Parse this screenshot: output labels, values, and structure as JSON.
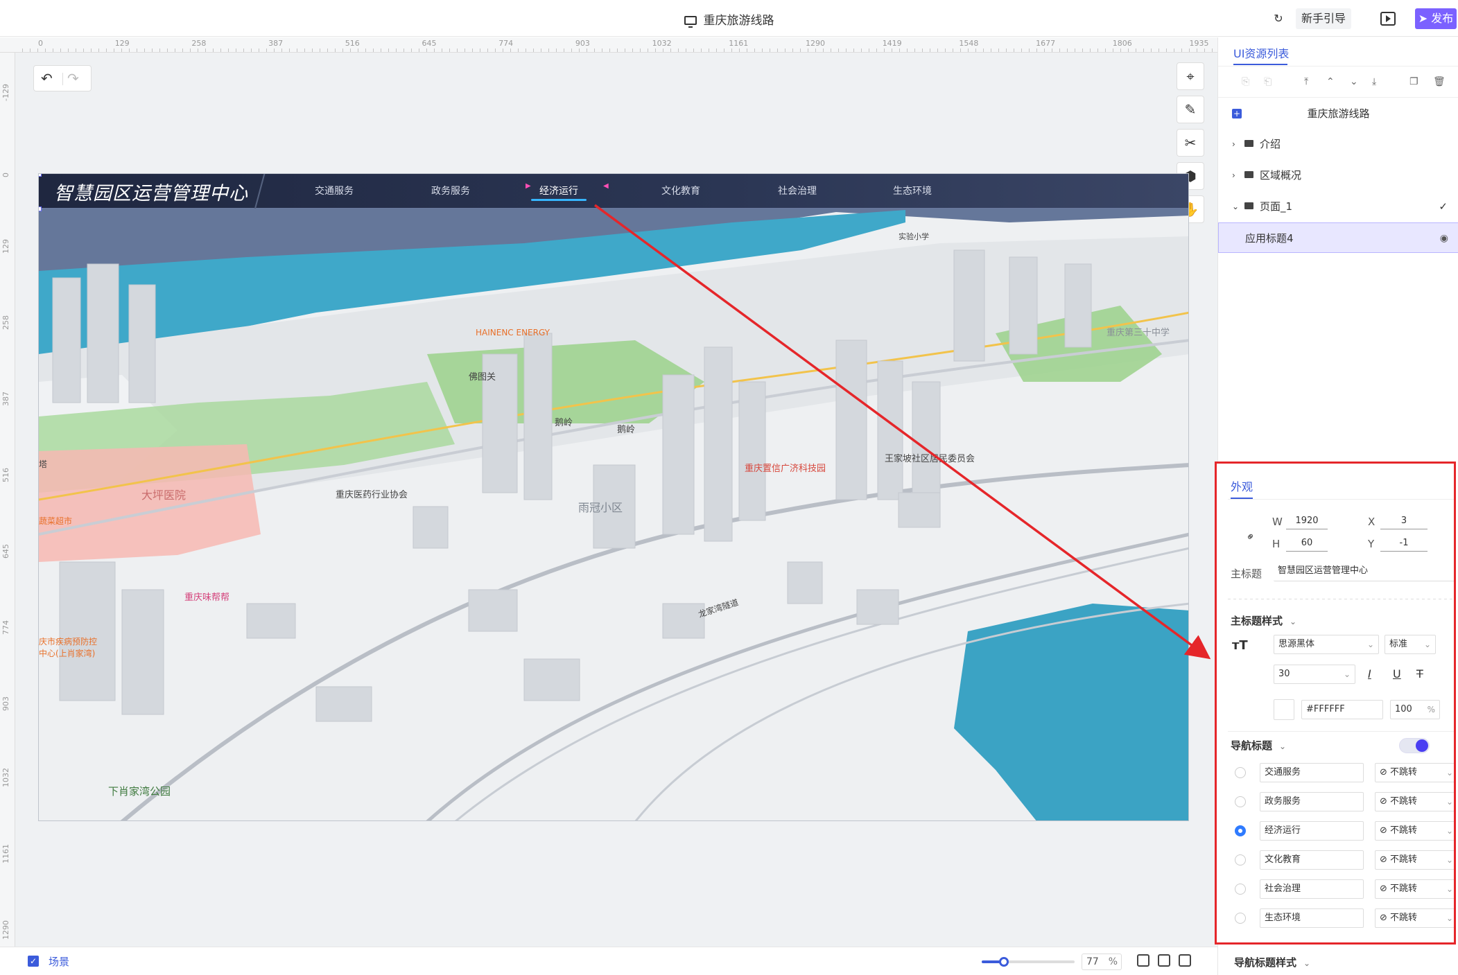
{
  "topbar": {
    "title": "重庆旅游线路",
    "cloud_icon": "↻",
    "guide_label": "新手引导",
    "publish_label": "➤ 发布"
  },
  "ruler": {
    "h_ticks": [
      "0",
      "129",
      "258",
      "387",
      "516",
      "645",
      "774",
      "903",
      "1032",
      "1161",
      "1290",
      "1419",
      "1548",
      "1677",
      "1806",
      "1935"
    ],
    "v_ticks": [
      "-129",
      "0",
      "129",
      "258",
      "387",
      "516",
      "645",
      "774",
      "903",
      "1032",
      "1161",
      "1290"
    ]
  },
  "toolbar": {
    "undo_icon": "↶",
    "redo_icon": "↷",
    "tools": [
      "⌖",
      "✎",
      "✂",
      "⬢",
      "✋"
    ]
  },
  "stage": {
    "header_title": "智慧园区运营管理中心",
    "nav": [
      "交通服务",
      "政务服务",
      "经济运行",
      "文化教育",
      "社会治理",
      "生态环境"
    ],
    "active_nav": 2,
    "map_labels": {
      "hainenc": "HAINENC ENERGY",
      "tiantuguan": "佛图关",
      "elin1": "鹅岭",
      "elin2": "鹅岭",
      "dahang": "大坪医院",
      "yaoye": "重庆医药行业协会",
      "shuiguan": "雨冠小区",
      "wangjiapo": "王家坡社区居民委员会",
      "jingji": "重庆置信广济科技园",
      "weibang": "重庆味帮帮",
      "jibing": "庆市疾病预防控",
      "jibing2": "中心(上肖家湾)",
      "xiaojiawan": "下肖家湾公园",
      "chaoshi": "蔬菜超市",
      "zhongxue": "重庆第三十中学",
      "shiyan": "实验小学",
      "longhu": "龙家湾隧道",
      "tower": "塔"
    }
  },
  "bottombar": {
    "scene_label": "场景",
    "zoom_value": "77",
    "zoom_unit": "%",
    "zoom_fraction": 0.24
  },
  "right_panel": {
    "tab_label": "UI资源列表",
    "icons": [
      "⎘",
      "⎗",
      "⤒",
      "⌃",
      "⌄",
      "⤓",
      "❐",
      "🗑"
    ],
    "tree": {
      "root": "重庆旅游线路",
      "items": [
        {
          "label": "介绍",
          "arrow": "›"
        },
        {
          "label": "区域概况",
          "arrow": "›"
        },
        {
          "label": "页面_1",
          "arrow": "⌄",
          "check": "✓"
        },
        {
          "label": "应用标题4",
          "eye": "◉"
        }
      ]
    }
  },
  "props": {
    "tab_label": "外观",
    "w_label": "W",
    "w_value": "1920",
    "h_label": "H",
    "h_value": "60",
    "x_label": "X",
    "x_value": "3",
    "y_label": "Y",
    "y_value": "-1",
    "main_title_label": "主标题",
    "main_title_value": "智慧园区运营管理中心",
    "main_style_title": "主标题样式",
    "font_family": "思源黑体",
    "font_weight": "标准",
    "font_size": "30",
    "color_hex": "#FFFFFF",
    "opacity": "100",
    "opacity_unit": "%",
    "nav_title": "导航标题",
    "nav_rows": [
      {
        "name": "交通服务",
        "jump": "⊘ 不跳转",
        "selected": false
      },
      {
        "name": "政务服务",
        "jump": "⊘ 不跳转",
        "selected": false
      },
      {
        "name": "经济运行",
        "jump": "⊘ 不跳转",
        "selected": true
      },
      {
        "name": "文化教育",
        "jump": "⊘ 不跳转",
        "selected": false
      },
      {
        "name": "社会治理",
        "jump": "⊘ 不跳转",
        "selected": false
      },
      {
        "name": "生态环境",
        "jump": "⊘ 不跳转",
        "selected": false
      }
    ],
    "nav_style_title": "导航标题样式"
  }
}
